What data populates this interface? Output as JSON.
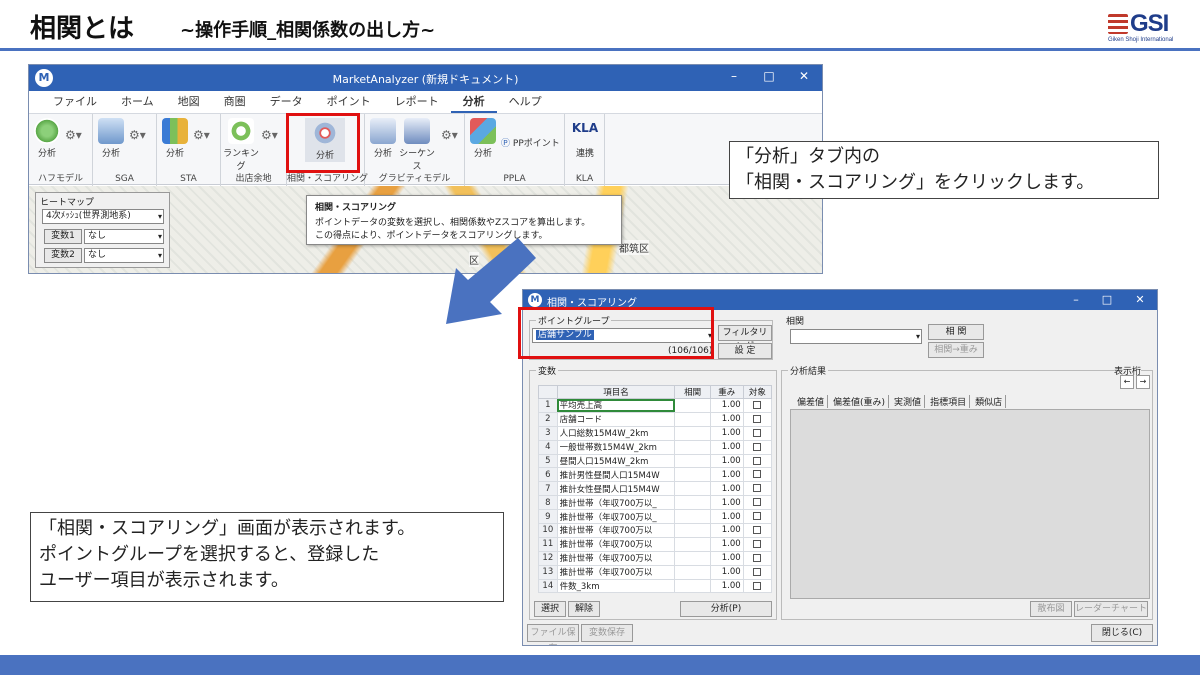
{
  "slide": {
    "title": "相関とは",
    "subtitle": "~操作手順_相関係数の出し方~",
    "logo_text": "GSI",
    "logo_sub": "Giken Shoji International"
  },
  "market_window": {
    "title": "MarketAnalyzer (新規ドキュメント)",
    "controls": [
      "–",
      "□",
      "✕"
    ],
    "menu": [
      "ファイル",
      "ホーム",
      "地図",
      "商圏",
      "データ",
      "ポイント",
      "レポート",
      "分析",
      "ヘルプ"
    ],
    "active_menu": "分析",
    "ribbon_groups": [
      {
        "label": "ハフモデル",
        "buttons": [
          "分析"
        ]
      },
      {
        "label": "SGA",
        "buttons": [
          "分析"
        ]
      },
      {
        "label": "STA",
        "buttons": [
          "分析"
        ]
      },
      {
        "label": "出店余地",
        "buttons": [
          "ランキング"
        ]
      },
      {
        "label": "相関・スコアリング",
        "buttons": [
          "分析"
        ]
      },
      {
        "label": "グラビティモデル",
        "buttons": [
          "分析",
          "シーケンス"
        ]
      },
      {
        "label": "PPLA",
        "buttons": [
          "分析",
          "PPポイント"
        ]
      },
      {
        "label": "KLA",
        "buttons": [
          "連携"
        ]
      }
    ],
    "kla_icon_text": "KLA",
    "heatmap": {
      "title": "ヒートマップ",
      "mesh": "4次ﾒｯｼｭ(世界測地系)",
      "var1_label": "変数1",
      "var1_value": "なし",
      "var2_label": "変数2",
      "var2_value": "なし"
    },
    "map_labels": [
      "都筑区",
      "区"
    ],
    "tooltip": {
      "title": "相関・スコアリング",
      "line1": "ポイントデータの変数を選択し、相関係数やZスコアを算出します。",
      "line2": "この得点により、ポイントデータをスコアリングします。"
    }
  },
  "callout_top": {
    "line1": "「分析」タブ内の",
    "line2": "「相関・スコアリング」をクリックします。"
  },
  "corr_window": {
    "title": "相関・スコアリング",
    "controls": [
      "–",
      "□",
      "✕"
    ],
    "point_group": {
      "legend": "ポイントグループ",
      "selected": "店舗サンプル",
      "count": "(106/106)",
      "filter_button": "フィルタリング",
      "settings_button": "設 定"
    },
    "correlation": {
      "legend": "相関",
      "select_value": "",
      "button": "相 関",
      "button2": "相関→重み"
    },
    "variables": {
      "legend": "変数",
      "columns": [
        "",
        "項目名",
        "相関",
        "重み",
        "対象"
      ],
      "rows": [
        {
          "no": "1",
          "name": "平均売上高",
          "weight": "1.00"
        },
        {
          "no": "2",
          "name": "店舗コード",
          "weight": "1.00"
        },
        {
          "no": "3",
          "name": "人口総数15M4W_2km",
          "weight": "1.00"
        },
        {
          "no": "4",
          "name": "一般世帯数15M4W_2km",
          "weight": "1.00"
        },
        {
          "no": "5",
          "name": "昼間人口15M4W_2km",
          "weight": "1.00"
        },
        {
          "no": "6",
          "name": "推計男性昼間人口15M4W",
          "weight": "1.00"
        },
        {
          "no": "7",
          "name": "推計女性昼間人口15M4W",
          "weight": "1.00"
        },
        {
          "no": "8",
          "name": "推計世帯（年収700万以_",
          "weight": "1.00"
        },
        {
          "no": "9",
          "name": "推計世帯（年収700万以_",
          "weight": "1.00"
        },
        {
          "no": "10",
          "name": "推計世帯（年収700万以",
          "weight": "1.00"
        },
        {
          "no": "11",
          "name": "推計世帯（年収700万以",
          "weight": "1.00"
        },
        {
          "no": "12",
          "name": "推計世帯（年収700万以",
          "weight": "1.00"
        },
        {
          "no": "13",
          "name": "推計世帯（年収700万以",
          "weight": "1.00"
        },
        {
          "no": "14",
          "name": "件数_3km",
          "weight": "1.00"
        }
      ],
      "select_button": "選択",
      "clear_button": "解除",
      "analyze_button": "分析(P)"
    },
    "results": {
      "legend": "分析結果",
      "display_label": "表示桁",
      "tabs": [
        "偏差値",
        "偏差値(重み)",
        "実測値",
        "指標項目",
        "類似店"
      ],
      "scatter_button": "散布図",
      "radar_button": "レーダーチャート"
    },
    "bottom": {
      "save_file": "ファイル保存",
      "save_vars": "変数保存",
      "close": "閉じる(C)"
    }
  },
  "callout_bottom": {
    "line1": "「相関・スコアリング」画面が表示されます。",
    "line2": "ポイントグループを選択すると、登録した",
    "line3": "ユーザー項目が表示されます。"
  },
  "colors": {
    "accent": "#4a72c0",
    "titlebar": "#2f62b5",
    "highlight": "#e01010"
  }
}
